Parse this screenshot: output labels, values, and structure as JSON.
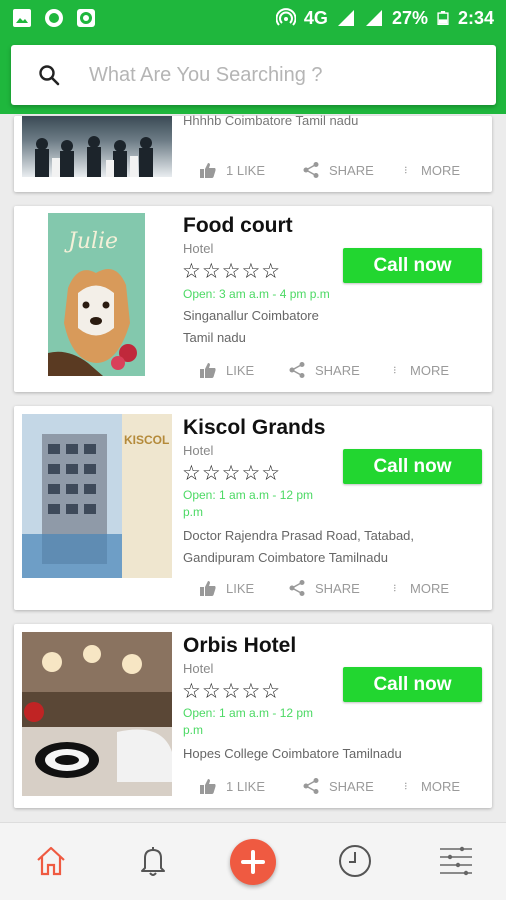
{
  "status_bar": {
    "network": "4G",
    "battery": "27%",
    "time": "2:34"
  },
  "search": {
    "placeholder": "What Are You Searching ?"
  },
  "colors": {
    "brand_green": "#1fb73d",
    "call_green": "#22d630",
    "open_green": "#4cd964",
    "accent_orange": "#ef5a41"
  },
  "cards": [
    {
      "address": "Hhhhb Coimbatore Tamil nadu",
      "like_label": "1 LIKE",
      "share_label": "SHARE",
      "more_label": "MORE"
    },
    {
      "title": "Food court",
      "category": "Hotel",
      "rating_stars": "☆☆☆☆☆",
      "open_text": "Open: 3 am a.m - 4 pm p.m",
      "address": "Singanallur Coimbatore Tamil nadu",
      "call_label": "Call now",
      "like_label": "LIKE",
      "share_label": "SHARE",
      "more_label": "MORE",
      "image_text": "Julie"
    },
    {
      "title": "Kiscol Grands",
      "category": "Hotel",
      "rating_stars": "☆☆☆☆☆",
      "open_text": "Open: 1 am a.m - 12 pm p.m",
      "address": "Doctor Rajendra Prasad Road, Tatabad, Gandipuram Coimbatore Tamilnadu",
      "call_label": "Call now",
      "like_label": "LIKE",
      "share_label": "SHARE",
      "more_label": "MORE",
      "image_text": "KISCOL GRANDS"
    },
    {
      "title": "Orbis Hotel",
      "category": "Hotel",
      "rating_stars": "☆☆☆☆☆",
      "open_text": "Open: 1 am a.m - 12 pm p.m",
      "address": "Hopes College Coimbatore Tamilnadu",
      "call_label": "Call now",
      "like_label": "1 LIKE",
      "share_label": "SHARE",
      "more_label": "MORE"
    }
  ],
  "bottom_nav": [
    "home-icon",
    "bell-icon",
    "add-icon",
    "history-icon",
    "filter-icon"
  ]
}
